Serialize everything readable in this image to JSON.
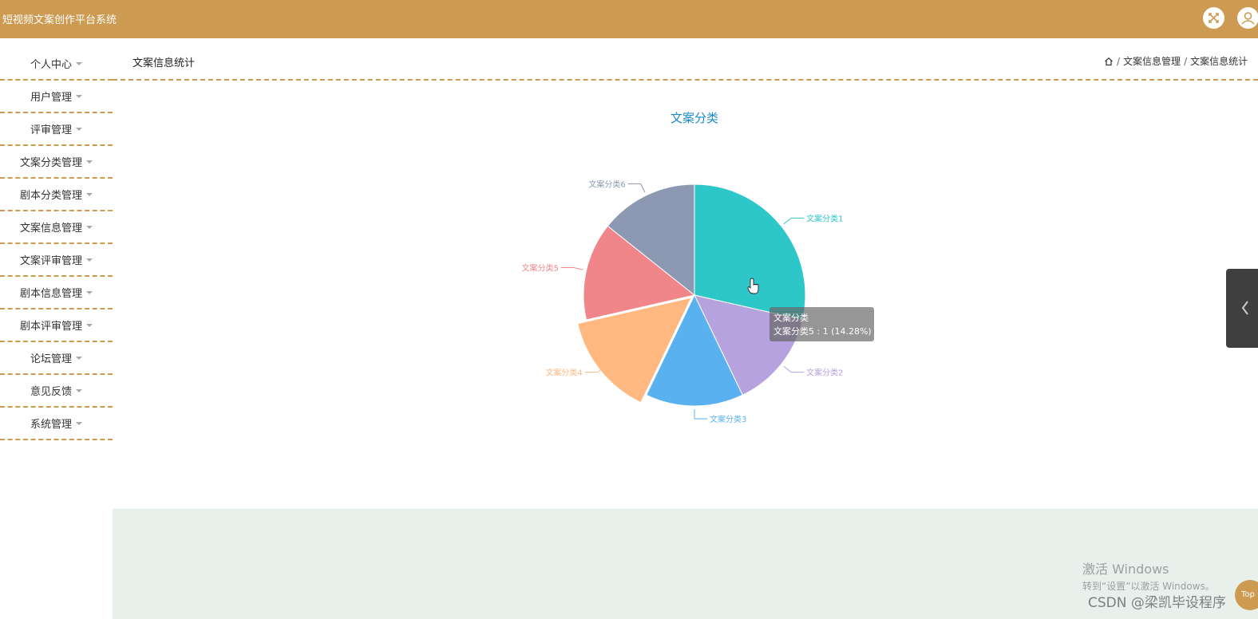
{
  "header": {
    "app_title": "短视频文案创作平台系统",
    "fullscreen_icon": "fullscreen-icon",
    "user_icon": "user-icon",
    "bg_color": "#cd9a52"
  },
  "sidebar": {
    "items": [
      {
        "label": "个人中心"
      },
      {
        "label": "用户管理"
      },
      {
        "label": "评审管理"
      },
      {
        "label": "文案分类管理"
      },
      {
        "label": "剧本分类管理"
      },
      {
        "label": "文案信息管理"
      },
      {
        "label": "文案评审管理"
      },
      {
        "label": "剧本信息管理"
      },
      {
        "label": "剧本评审管理"
      },
      {
        "label": "论坛管理"
      },
      {
        "label": "意见反馈"
      },
      {
        "label": "系统管理"
      }
    ]
  },
  "page": {
    "title": "文案信息统计",
    "breadcrumb": [
      "文案信息管理",
      "文案信息统计"
    ],
    "home_icon": "home-icon"
  },
  "chart_data": {
    "type": "pie",
    "title": "文案分类",
    "categories": [
      "文案分类1",
      "文案分类2",
      "文案分类3",
      "文案分类4",
      "文案分类5",
      "文案分类6"
    ],
    "values": [
      2,
      1,
      1,
      1,
      1,
      1
    ],
    "colors": [
      "#2ec7c9",
      "#b6a2de",
      "#5ab1ef",
      "#ffb980",
      "#f0868a",
      "#8d98b3"
    ],
    "highlighted": "文案分类4",
    "tooltip": {
      "title": "文案分类",
      "text": "文案分类5 : 1 (14.28%)"
    }
  },
  "watermarks": {
    "windows_line1": "激活 Windows",
    "windows_line2": "转到“设置”以激活 Windows。",
    "csdn": "CSDN @梁凯毕设程序"
  },
  "back_to_top": "Top"
}
